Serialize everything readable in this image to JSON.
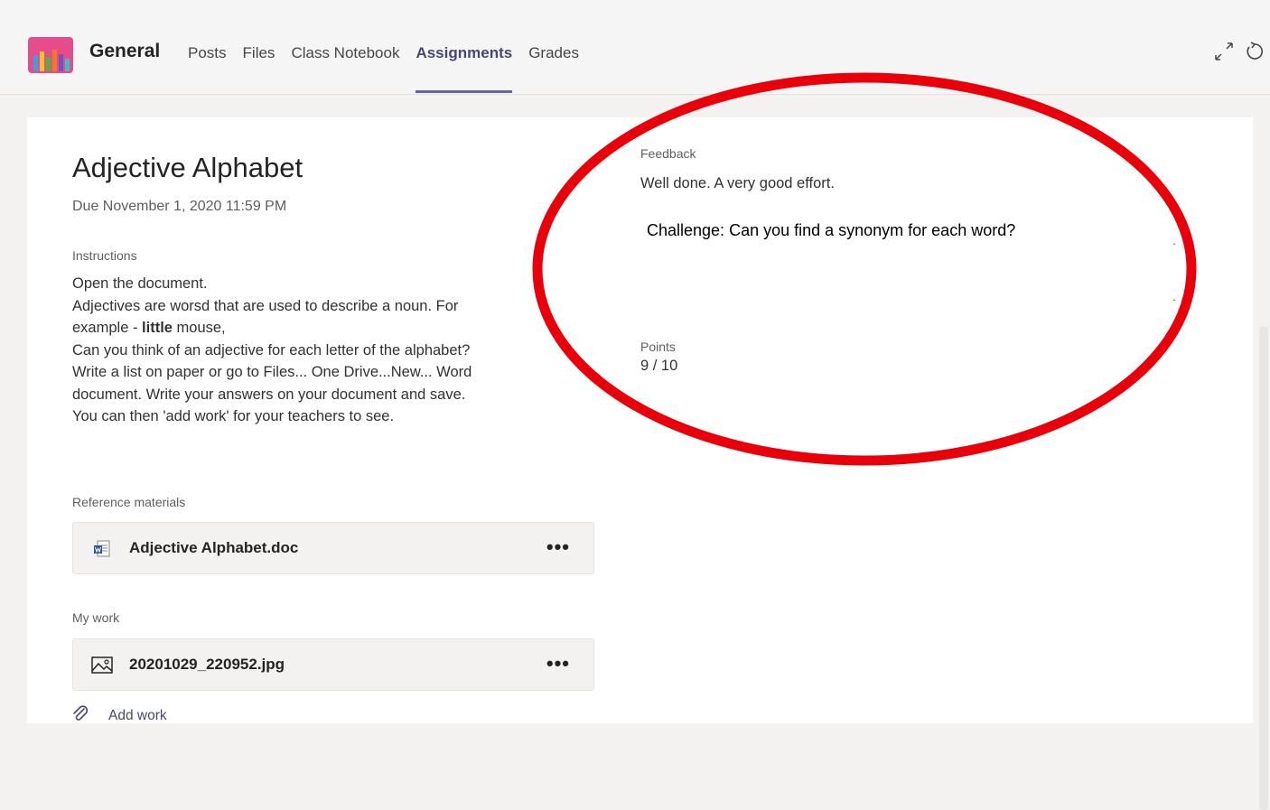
{
  "header": {
    "team_name": "General",
    "tabs": [
      {
        "label": "Posts",
        "active": false
      },
      {
        "label": "Files",
        "active": false
      },
      {
        "label": "Class Notebook",
        "active": false
      },
      {
        "label": "Assignments",
        "active": true
      },
      {
        "label": "Grades",
        "active": false
      }
    ],
    "icons": [
      "expand-icon",
      "refresh-icon"
    ],
    "accent_color": "#6264a7"
  },
  "assignment": {
    "title": "Adjective Alphabet",
    "due": "Due November 1, 2020 11:59 PM",
    "instructions_label": "Instructions",
    "instructions": {
      "line1": "Open the document.",
      "line2": "Adjectives are worsd that are used to describe a noun. For",
      "line3_prefix": "example - ",
      "line3_bold": "little",
      "line3_suffix": " mouse,",
      "line4": "Can you think of an adjective for each letter of the alphabet?",
      "line5": "Write a list on paper or go to Files... One Drive...New... Word",
      "line6": "document. Write your answers on your document and save.",
      "line7": "You can then 'add work' for your teachers to see."
    },
    "reference_label": "Reference materials",
    "reference_file": {
      "name": "Adjective Alphabet.doc",
      "icon": "word-doc-icon",
      "more": "•••"
    },
    "my_work_label": "My work",
    "my_work_file": {
      "name": "20201029_220952.jpg",
      "icon": "image-file-icon",
      "more": "•••"
    },
    "add_work_label": "Add work"
  },
  "feedback": {
    "label": "Feedback",
    "text": "Well done.  A very good effort.",
    "challenge": "Challenge: Can you find a synonym for each word?",
    "points_label": "Points",
    "points": "9 / 10",
    "annotation_color": "#e8000b"
  }
}
